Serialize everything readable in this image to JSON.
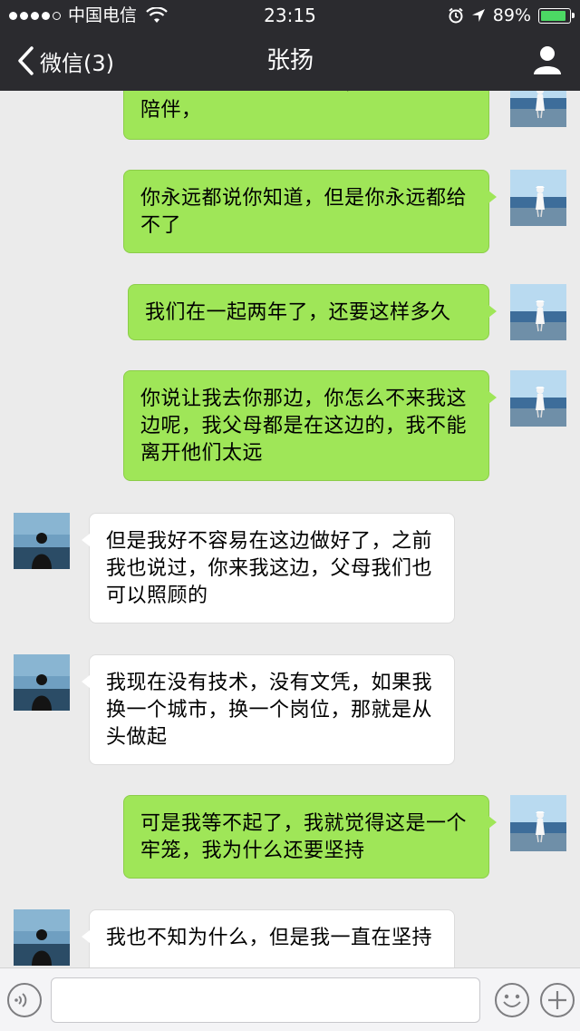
{
  "status_bar": {
    "carrier": "中国电信",
    "time": "23:15",
    "battery_percent": "89%",
    "battery_level": 0.89
  },
  "nav": {
    "back_label": "微信(3)",
    "title": "张扬"
  },
  "messages": [
    {
      "side": "out",
      "text": "我受不了这样的生活了，我需要的是陪伴，",
      "avatar": "girl-at-sea-avatar"
    },
    {
      "side": "out",
      "text": "你永远都说你知道，但是你永远都给不了",
      "avatar": "girl-at-sea-avatar"
    },
    {
      "side": "out",
      "text": "我们在一起两年了，还要这样多久",
      "avatar": "girl-at-sea-avatar"
    },
    {
      "side": "out",
      "text": "你说让我去你那边，你怎么不来我这边呢，我父母都是在这边的，我不能离开他们太远",
      "avatar": "girl-at-sea-avatar"
    },
    {
      "side": "in",
      "text": "但是我好不容易在这边做好了，之前我也说过，你来我这边，父母我们也可以照顾的",
      "avatar": "man-silhouette-avatar"
    },
    {
      "side": "in",
      "text": "我现在没有技术，没有文凭，如果我换一个城市，换一个岗位，那就是从头做起",
      "avatar": "man-silhouette-avatar"
    },
    {
      "side": "out",
      "text": "可是我等不起了，我就觉得这是一个牢笼，我为什么还要坚持",
      "avatar": "girl-at-sea-avatar"
    },
    {
      "side": "in",
      "text": "我也不知为什么，但是我一直在坚持",
      "avatar": "man-silhouette-avatar"
    }
  ],
  "input_bar": {
    "voice_icon": "voice-icon",
    "emoji_icon": "emoji-icon",
    "plus_icon": "plus-icon",
    "text_value": ""
  }
}
